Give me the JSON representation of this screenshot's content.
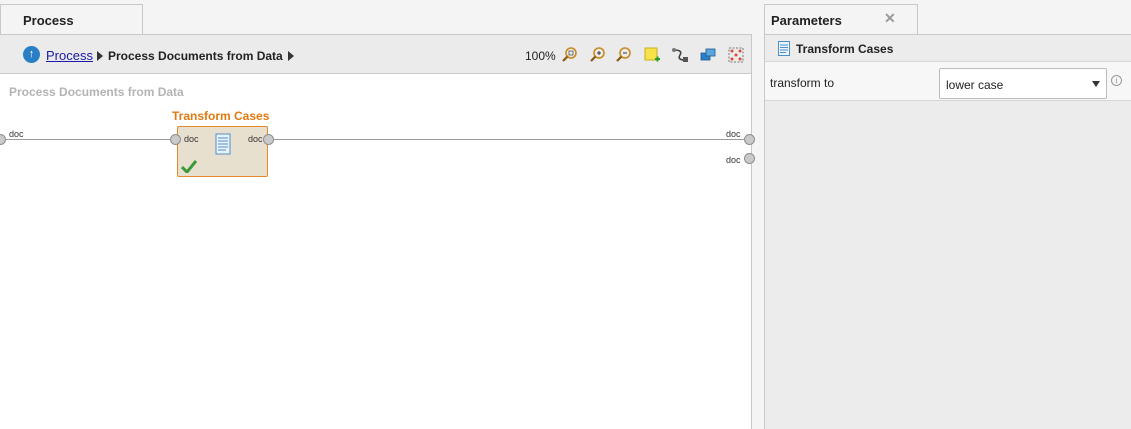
{
  "process_tab": {
    "label": "Process"
  },
  "breadcrumb": {
    "root": "Process",
    "current": "Process Documents from Data"
  },
  "toolbar": {
    "zoom": "100%",
    "tools": [
      "zoom-fit-icon",
      "zoom-in-icon",
      "zoom-out-icon",
      "add-note-icon",
      "auto-wire-icon",
      "arrange-icon",
      "fit-selection-icon"
    ]
  },
  "canvas": {
    "title": "Process Documents from Data",
    "input_port": "doc",
    "output_ports": [
      "doc",
      "doc"
    ],
    "operator": {
      "name": "Transform Cases",
      "in_port": "doc",
      "out_port": "doc",
      "status": "check-icon"
    }
  },
  "params_tab": {
    "label": "Parameters",
    "close": "✕"
  },
  "params": {
    "operator": "Transform Cases",
    "rows": [
      {
        "label": "transform to",
        "value": "lower case",
        "info": "i"
      }
    ]
  },
  "colors": {
    "accent": "#e07a10",
    "link": "#1a1aa6",
    "operator_bg": "#e8e0cf"
  }
}
